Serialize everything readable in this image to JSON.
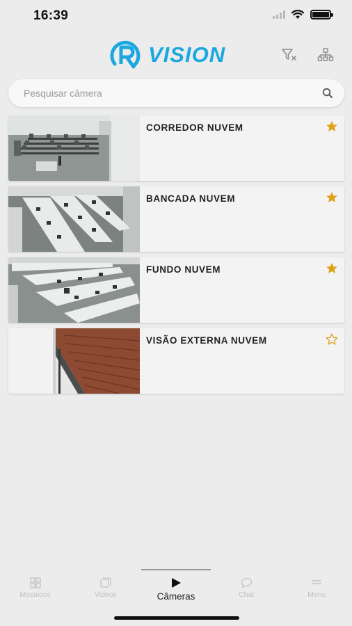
{
  "status_bar": {
    "time": "16:39"
  },
  "header": {
    "logo_text": "VISION",
    "brand_color": "#1ba7e0",
    "actions": [
      {
        "icon": "filter-clear-icon"
      },
      {
        "icon": "hierarchy-icon"
      }
    ]
  },
  "search": {
    "placeholder": "Pesquisar câmera",
    "value": ""
  },
  "cameras": [
    {
      "name": "CORREDOR NUVEM",
      "favorite": true,
      "thumbnail": "office-room-wide"
    },
    {
      "name": "BANCADA NUVEM",
      "favorite": true,
      "thumbnail": "office-desks-rows"
    },
    {
      "name": "FUNDO NUVEM",
      "favorite": true,
      "thumbnail": "office-back-room"
    },
    {
      "name": "VISÃO EXTERNA NUVEM",
      "favorite": false,
      "thumbnail": "exterior-roof"
    }
  ],
  "colors": {
    "star": "#e0a21a",
    "background": "#ececec"
  },
  "bottom_nav": [
    {
      "label": "Mosaicos",
      "icon": "grid-icon",
      "active": false
    },
    {
      "label": "Videos",
      "icon": "video-icon",
      "active": false
    },
    {
      "label": "Câmeras",
      "icon": "play-icon",
      "active": true
    },
    {
      "label": "Chat",
      "icon": "chat-icon",
      "active": false
    },
    {
      "label": "Menu",
      "icon": "menu-icon",
      "active": false
    }
  ]
}
